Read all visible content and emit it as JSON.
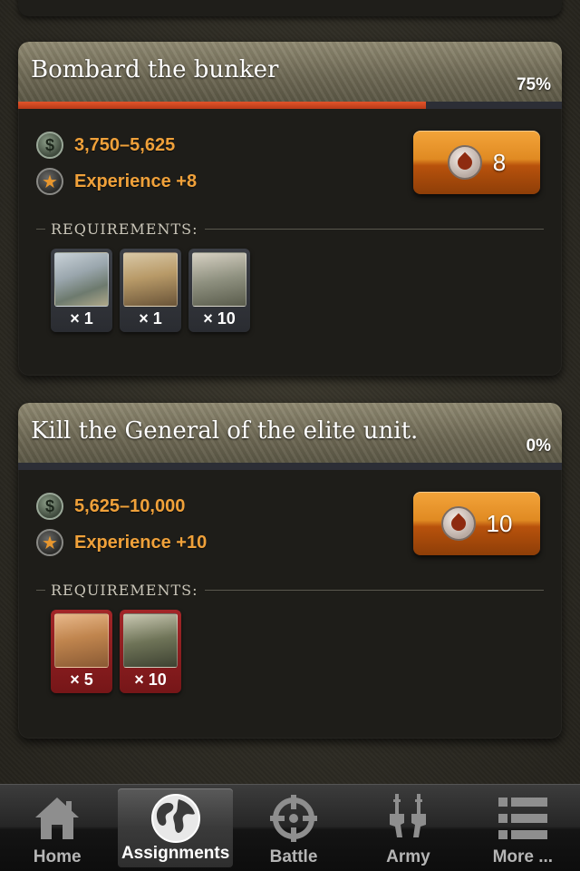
{
  "assignments": [
    {
      "title": "Bombard the bunker",
      "percent": "75%",
      "progress": 0.75,
      "money": "3,750–5,625",
      "experience": "Experience +8",
      "energy_cost": "8",
      "requirements_label": "REQUIREMENTS:",
      "requirements": [
        {
          "item": "fighter jets",
          "qty": "× 1",
          "status": "met"
        },
        {
          "item": "armored truck",
          "qty": "× 1",
          "status": "met"
        },
        {
          "item": "soldiers",
          "qty": "× 10",
          "status": "met"
        }
      ]
    },
    {
      "title": "Kill the General of the elite unit.",
      "percent": "0%",
      "progress": 0.0,
      "money": "5,625–10,000",
      "experience": "Experience +10",
      "energy_cost": "10",
      "requirements_label": "REQUIREMENTS:",
      "requirements": [
        {
          "item": "jeep",
          "qty": "× 5",
          "status": "missing"
        },
        {
          "item": "militia",
          "qty": "× 10",
          "status": "missing"
        }
      ]
    }
  ],
  "tabbar": {
    "items": [
      {
        "label": "Home",
        "icon": "home-icon",
        "active": false
      },
      {
        "label": "Assignments",
        "icon": "globe-icon",
        "active": true
      },
      {
        "label": "Battle",
        "icon": "crosshair-icon",
        "active": false
      },
      {
        "label": "Army",
        "icon": "rifles-icon",
        "active": false
      },
      {
        "label": "More ...",
        "icon": "list-icon",
        "active": false
      }
    ]
  },
  "colors": {
    "accent_text": "#f0a13a",
    "progress_fill": "#d5461f",
    "button_orange": "#e08a22",
    "missing_red": "#a32628"
  }
}
